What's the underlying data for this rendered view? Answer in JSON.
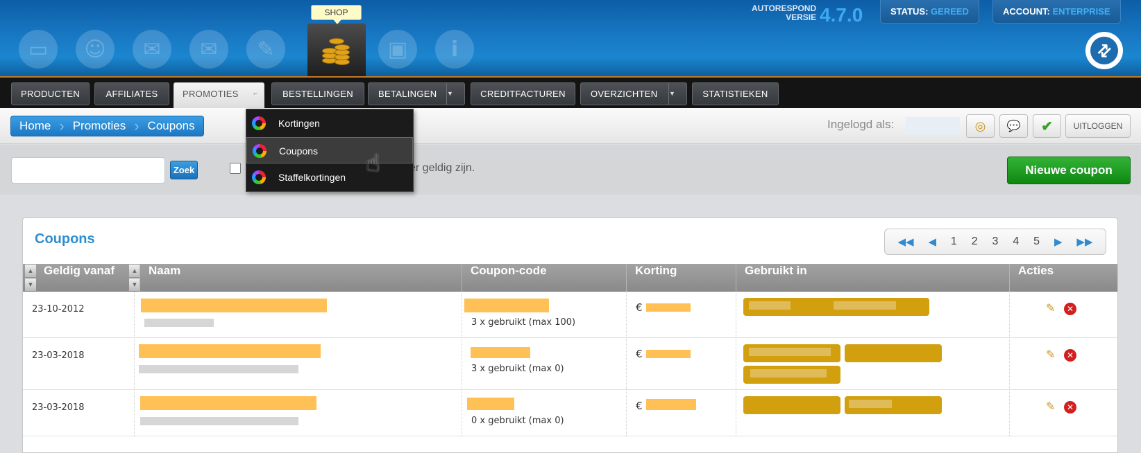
{
  "header": {
    "shop_label": "SHOP",
    "icons": [
      "monitor-icon",
      "user-icon",
      "chat-icon",
      "envelope-icon",
      "document-pen-icon",
      "coins-icon",
      "floppy-disk-icon",
      "info-icon"
    ],
    "version_label_1": "AUTORESPOND",
    "version_label_2": "VERSIE",
    "version": "4.7.0",
    "status_label": "STATUS:",
    "status_value": "GEREED",
    "account_label": "ACCOUNT:",
    "account_value": "ENTERPRISE"
  },
  "nav": {
    "items": [
      "PRODUCTEN",
      "AFFILIATES",
      "PROMOTIES",
      "BESTELLINGEN",
      "BETALINGEN",
      "CREDITFACTUREN",
      "OVERZICHTEN",
      "STATISTIEKEN"
    ],
    "active": "PROMOTIES"
  },
  "dropdown": {
    "items": [
      "Kortingen",
      "Coupons",
      "Staffelkortingen"
    ],
    "highlighted": "Coupons"
  },
  "breadcrumb": [
    "Home",
    "Promoties",
    "Coupons"
  ],
  "login": {
    "label": "Ingelogd als:",
    "logout": "UITLOGGEN"
  },
  "filter": {
    "search_value": "",
    "search_button": "Zoek",
    "checkbox_label_visible": "er geldig zijn.",
    "new_button": "Nieuwe coupon"
  },
  "panel": {
    "title": "Coupons",
    "pages": [
      "1",
      "2",
      "3",
      "4",
      "5"
    ]
  },
  "table": {
    "columns": [
      "Geldig vanaf",
      "Naam",
      "Coupon-code",
      "Korting",
      "Gebruikt in",
      "Acties"
    ],
    "rows": [
      {
        "date": "23-10-2012",
        "used": "3 x gebruikt (max 100)",
        "currency": "€"
      },
      {
        "date": "23-03-2018",
        "used": "3 x gebruikt (max 0)",
        "currency": "€"
      },
      {
        "date": "23-03-2018",
        "used": "0 x gebruikt (max 0)",
        "currency": "€"
      }
    ]
  },
  "colors": {
    "header_blue": "#1877c2",
    "accent_blue": "#41aef5",
    "new_button_green": "#1a9c1d",
    "redaction_orange": "#ffc055",
    "tag_gold": "#d29f0e",
    "delete_red": "#d21f1f"
  }
}
